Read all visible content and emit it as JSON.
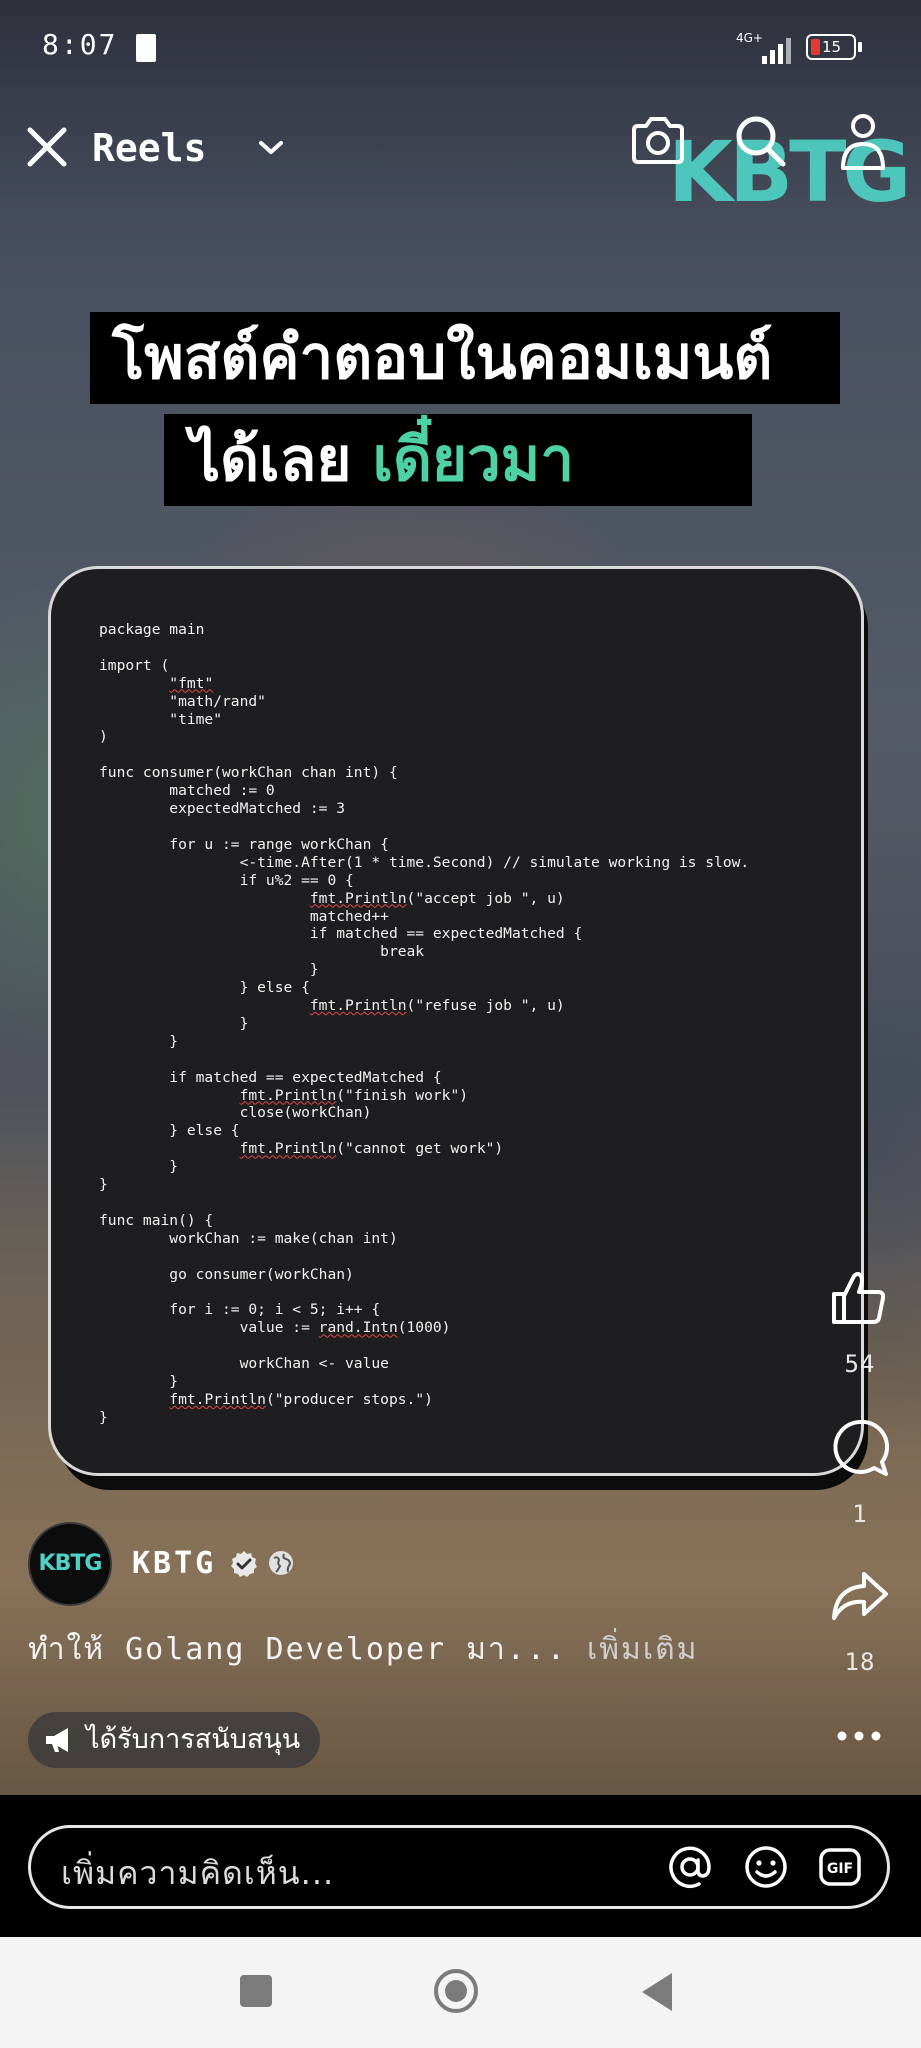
{
  "status_bar": {
    "time": "8:07",
    "network": "4G+",
    "battery": "15"
  },
  "top_bar": {
    "title": "Reels",
    "watermark": "KBTG"
  },
  "headline": {
    "line1": "โพสต์คำตอบในคอมเมนต์",
    "line2_white": "ได้เลย",
    "line2_green": "เดี๋ยวมา",
    "accent_color": "#4fd1a8"
  },
  "code_lines": [
    "package main",
    "",
    "import (",
    "        \"fmt\"",
    "        \"math/rand\"",
    "        \"time\"",
    ")",
    "",
    "func consumer(workChan chan int) {",
    "        matched := 0",
    "        expectedMatched := 3",
    "",
    "        for u := range workChan {",
    "                <-time.After(1 * time.Second) // simulate working is slow.",
    "                if u%2 == 0 {",
    "                        fmt.Println(\"accept job \", u)",
    "                        matched++",
    "                        if matched == expectedMatched {",
    "                                break",
    "                        }",
    "                } else {",
    "                        fmt.Println(\"refuse job \", u)",
    "                }",
    "        }",
    "",
    "        if matched == expectedMatched {",
    "                fmt.Println(\"finish work\")",
    "                close(workChan)",
    "        } else {",
    "                fmt.Println(\"cannot get work\")",
    "        }",
    "}",
    "",
    "func main() {",
    "        workChan := make(chan int)",
    "",
    "        go consumer(workChan)",
    "",
    "        for i := 0; i < 5; i++ {",
    "                value := rand.Intn(1000)",
    "",
    "                workChan <- value",
    "        }",
    "        fmt.Println(\"producer stops.\")",
    "}"
  ],
  "actions": {
    "likes": "54",
    "comments": "1",
    "shares": "18"
  },
  "author": {
    "avatar_text": "KBTG",
    "name": "KBTG"
  },
  "caption": {
    "text": "ทำให้ Golang Developer มา...",
    "more": "เพิ่มเติม"
  },
  "sponsor_label": "ได้รับการสนับสนุน",
  "comment": {
    "placeholder": "เพิ่มความคิดเห็น..."
  },
  "icons": {
    "close": "close-icon",
    "chevron": "chevron-down-icon",
    "camera": "camera-icon",
    "search": "search-icon",
    "profile": "person-icon",
    "like": "thumbs-up-icon",
    "comment": "comment-bubble-icon",
    "share": "share-arrow-icon",
    "more": "more-dots-icon",
    "mention": "at-icon",
    "emoji": "emoji-icon",
    "gif": "gif-icon"
  }
}
